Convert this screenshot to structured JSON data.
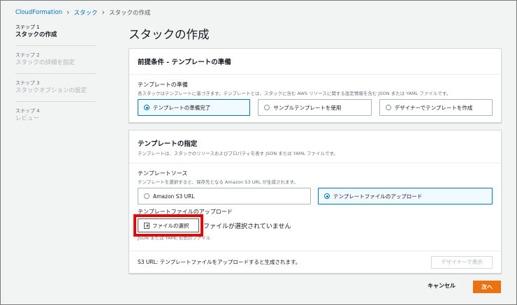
{
  "breadcrumb": {
    "items": [
      "CloudFormation",
      "スタック"
    ],
    "current": "スタックの作成"
  },
  "steps": [
    {
      "num": "ステップ 1",
      "title": "スタックの作成"
    },
    {
      "num": "ステップ 2",
      "title": "スタックの詳細を指定"
    },
    {
      "num": "ステップ 3",
      "title": "スタックオプションの設定"
    },
    {
      "num": "ステップ 4",
      "title": "レビュー"
    }
  ],
  "page_title": "スタックの作成",
  "prereq": {
    "header": "前提条件 - テンプレートの準備",
    "label": "テンプレートの準備",
    "desc": "各スタックはテンプレートに基づきます。テンプレートとは、スタックに含む AWS リソースに関する設定情報を含む JSON または YAML ファイルです。",
    "options": [
      "テンプレートの準備完了",
      "サンプルテンプレートを使用",
      "デザイナーでテンプレートを作成"
    ],
    "selected_index": 0
  },
  "template": {
    "header": "テンプレートの指定",
    "header_desc": "テンプレートは、スタックのリソースおよびプロパティを表す JSON または YAML ファイルです。",
    "source_label": "テンプレートソース",
    "source_desc": "テンプレートを選択すると、保存先となる Amazon S3 URL が生成されます。",
    "source_options": [
      "Amazon S3 URL",
      "テンプレートファイルのアップロード"
    ],
    "selected_index": 1,
    "upload_label": "テンプレートファイルのアップロード",
    "file_button": "ファイルの選択",
    "no_file": "ファイルが選択されていません",
    "file_hint": "JSON または YAML 形式のファイル",
    "s3_text": "S3 URL:  テンプレートファイルをアップロードすると生成されます。",
    "designer_button": "デザイナーで表示"
  },
  "actions": {
    "cancel": "キャンセル",
    "next": "次へ"
  },
  "colors": {
    "accent": "#0073bb",
    "primary_button": "#ec7211",
    "highlight": "#e00000"
  }
}
